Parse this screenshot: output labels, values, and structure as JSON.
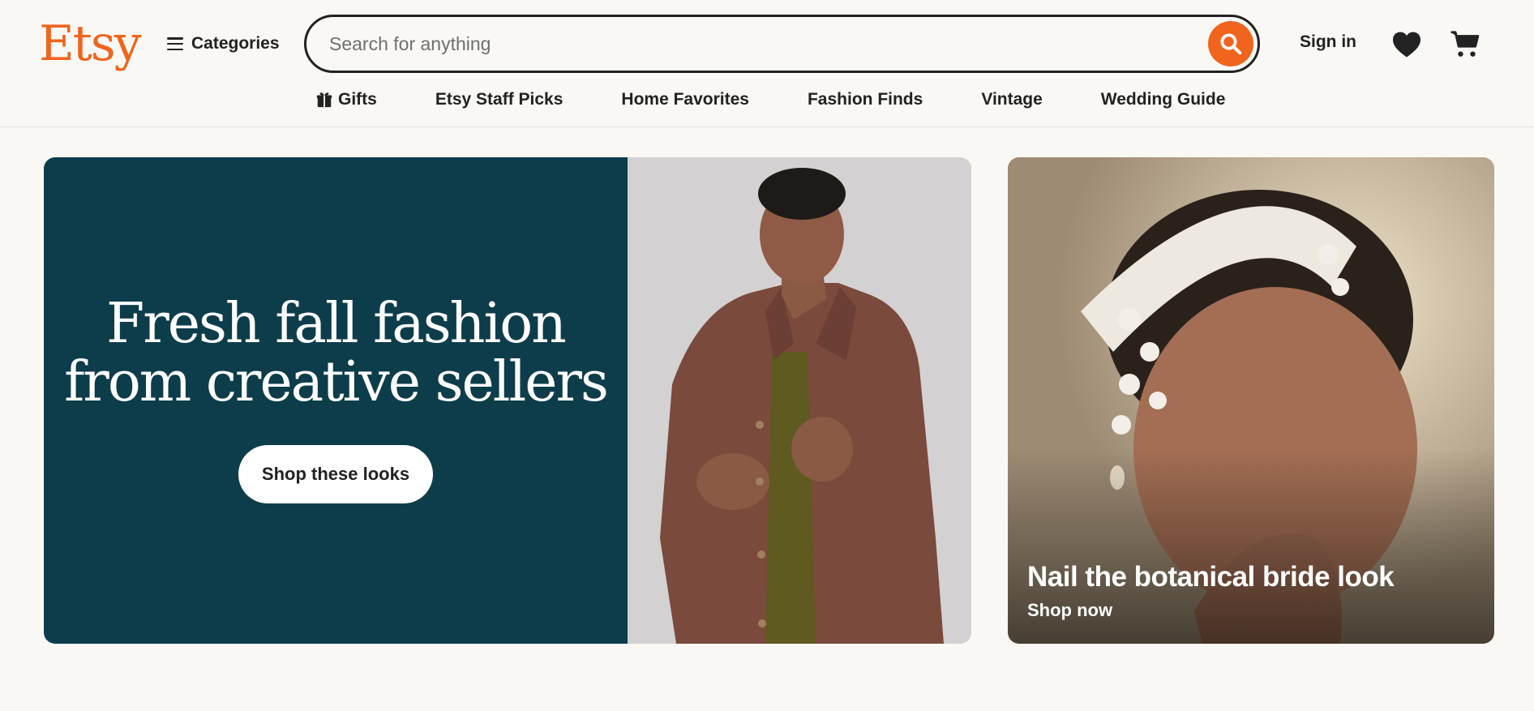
{
  "header": {
    "logo": "Etsy",
    "categories_label": "Categories",
    "search_placeholder": "Search for anything",
    "signin_label": "Sign in"
  },
  "nav": {
    "items": [
      {
        "label": "Gifts",
        "icon": "gift-icon"
      },
      {
        "label": "Etsy Staff Picks"
      },
      {
        "label": "Home Favorites"
      },
      {
        "label": "Fashion Finds"
      },
      {
        "label": "Vintage"
      },
      {
        "label": "Wedding Guide"
      }
    ]
  },
  "hero": {
    "title_line1": "Fresh fall fashion",
    "title_line2": "from creative sellers",
    "cta_label": "Shop these looks"
  },
  "promo": {
    "title": "Nail the botanical bride look",
    "link_label": "Shop now"
  },
  "colors": {
    "brand_orange": "#f1641e",
    "hero_teal": "#0d3d4b",
    "page_bg": "#f9f8f4",
    "text_dark": "#222222"
  }
}
